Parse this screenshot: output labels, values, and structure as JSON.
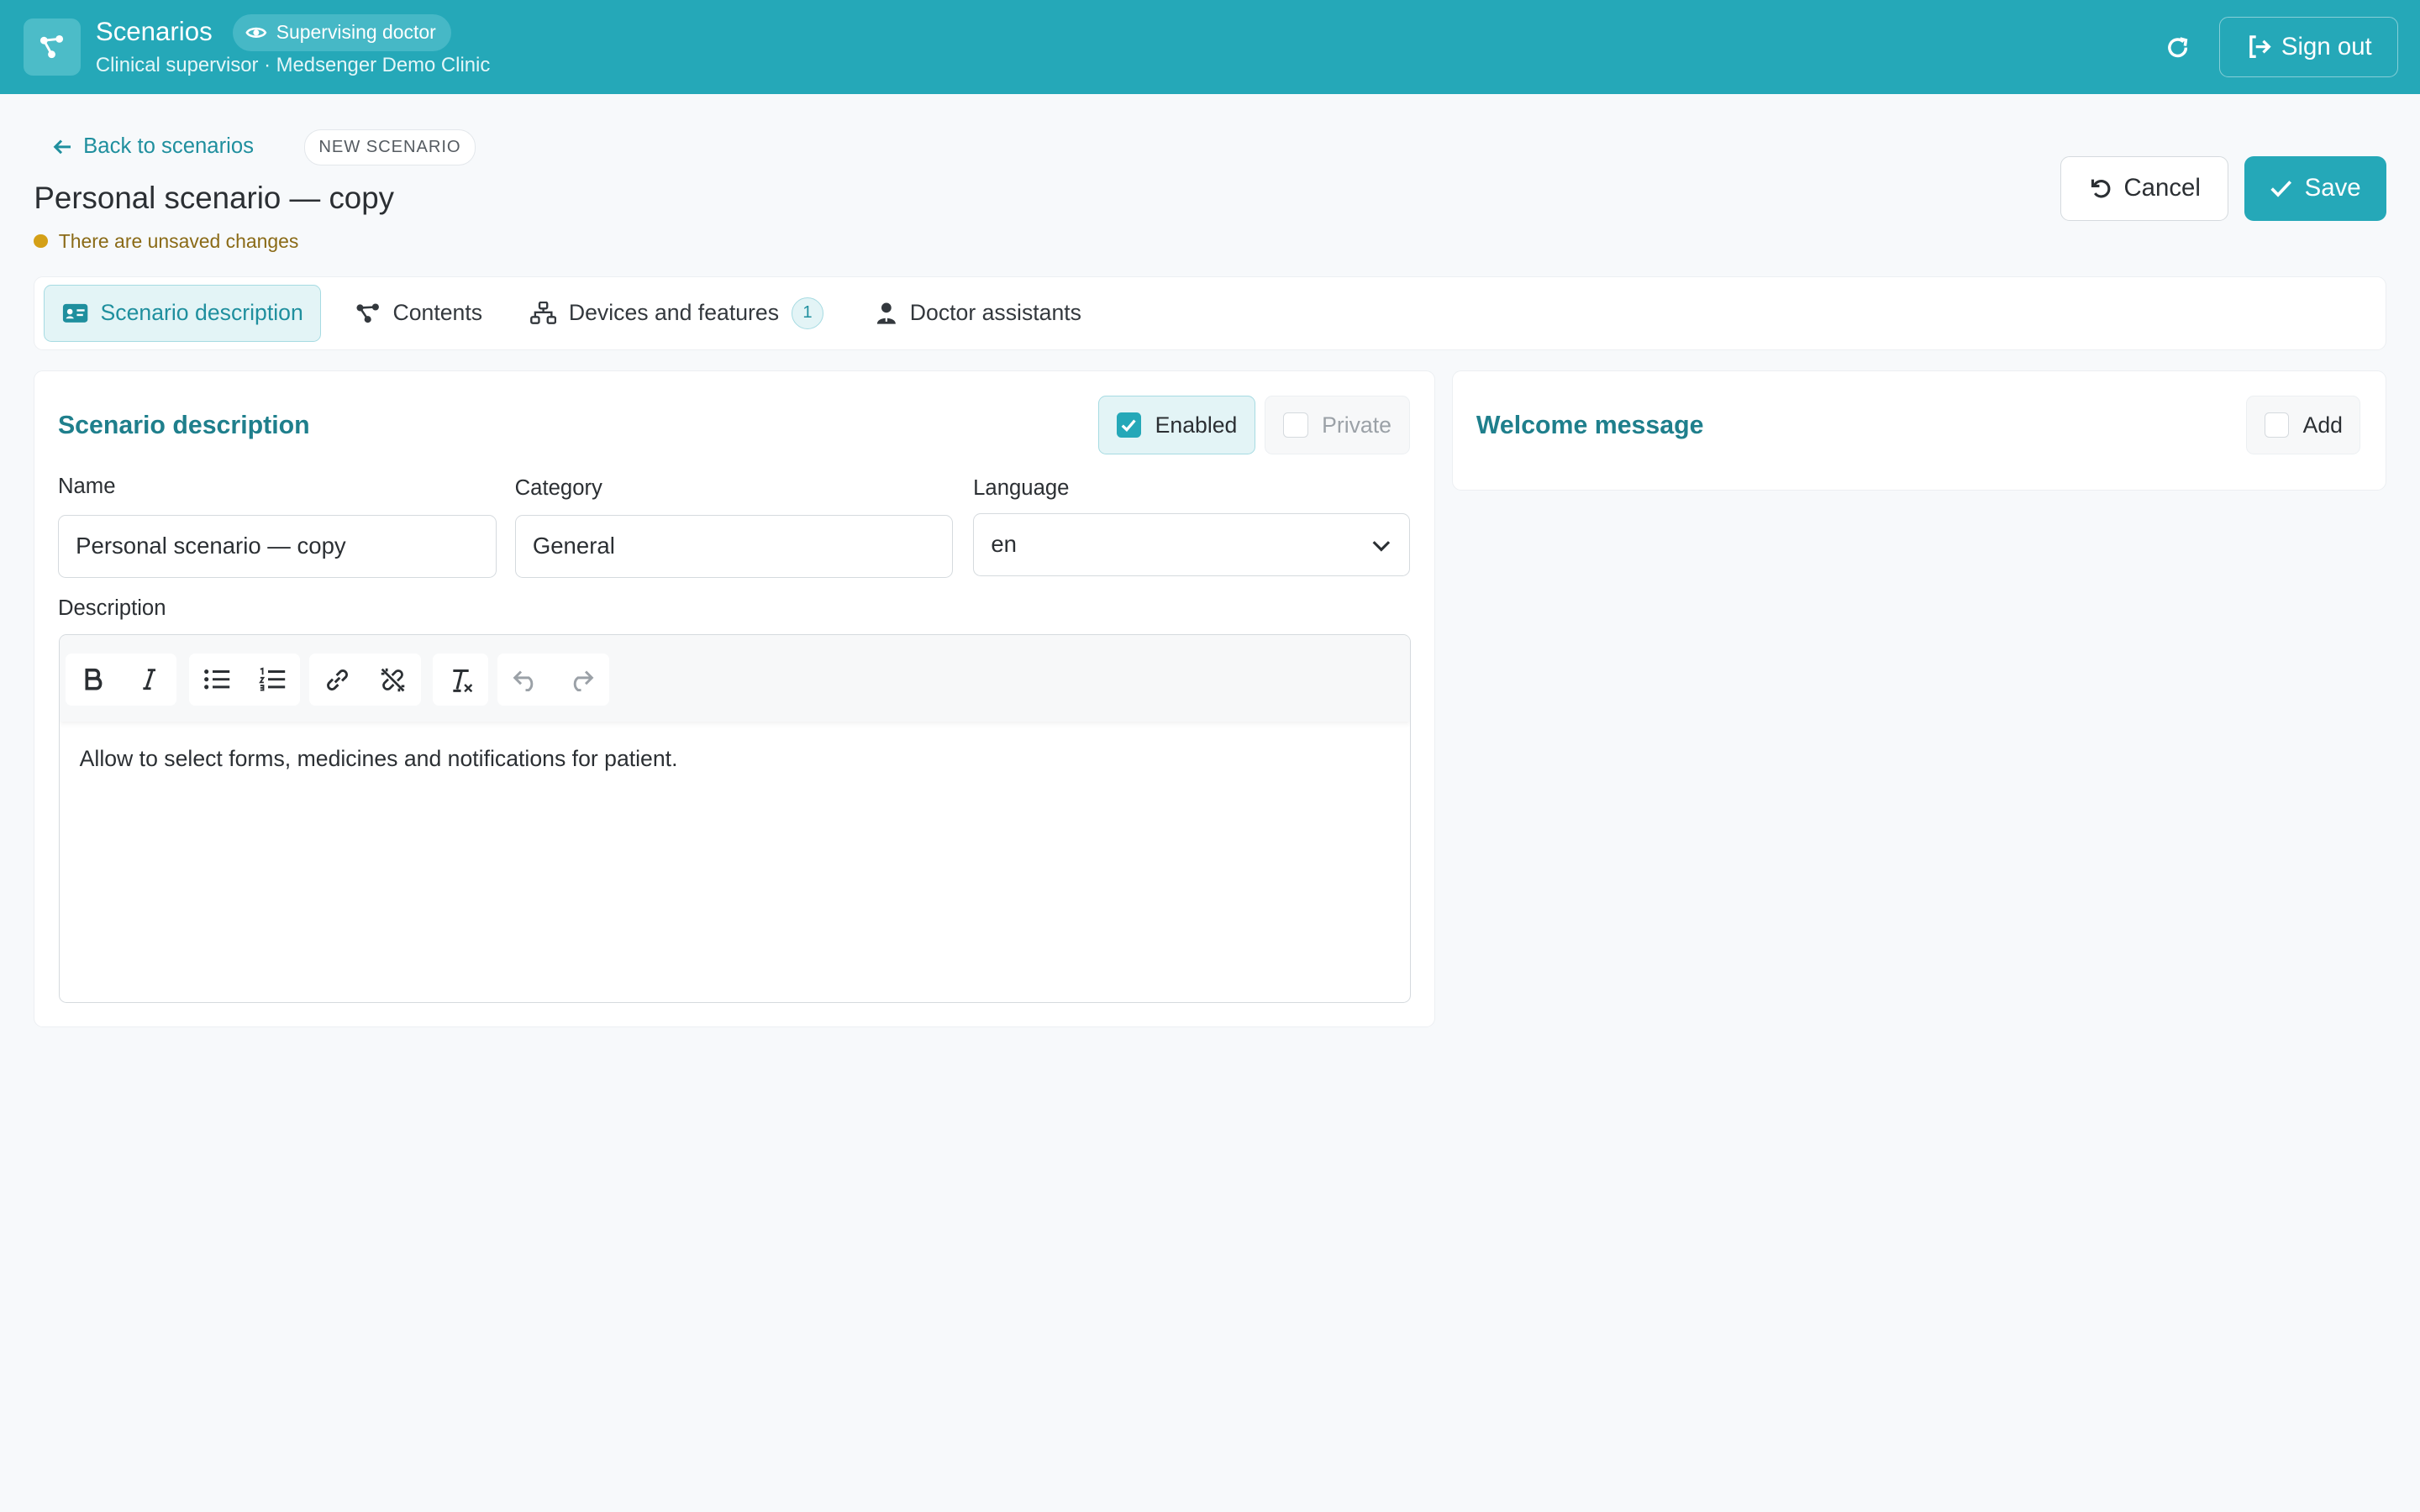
{
  "header": {
    "app_title": "Scenarios",
    "role_badge": "Supervising doctor",
    "subtitle": "Clinical supervisor · Medsenger Demo Clinic",
    "signout_label": "Sign out",
    "brand_color": "#25a8b8"
  },
  "page": {
    "back_label": "Back to scenarios",
    "badge": "NEW SCENARIO",
    "title": "Personal scenario — copy",
    "unsaved": "There are unsaved changes",
    "cancel_label": "Cancel",
    "save_label": "Save"
  },
  "tabs": [
    {
      "label": "Scenario description",
      "icon": "id-card-icon",
      "active": true
    },
    {
      "label": "Contents",
      "icon": "nodes-icon"
    },
    {
      "label": "Devices and features",
      "icon": "sitemap-icon",
      "count": "1"
    },
    {
      "label": "Doctor assistants",
      "icon": "user-doctor-icon"
    }
  ],
  "description_card": {
    "title": "Scenario description",
    "enabled_label": "Enabled",
    "enabled_checked": true,
    "private_label": "Private",
    "private_checked": false,
    "name_label": "Name",
    "name_value": "Personal scenario — copy",
    "category_label": "Category",
    "category_value": "General",
    "language_label": "Language",
    "language_value": "en",
    "description_label": "Description",
    "description_text": "Allow to select forms, medicines and notifications for patient."
  },
  "editor_toolbar": [
    "bold-icon",
    "italic-icon",
    "bullet-list-icon",
    "numbered-list-icon",
    "link-icon",
    "unlink-icon",
    "clear-format-icon",
    "undo-icon",
    "redo-icon"
  ],
  "welcome_card": {
    "title": "Welcome message",
    "add_label": "Add",
    "add_checked": false
  }
}
